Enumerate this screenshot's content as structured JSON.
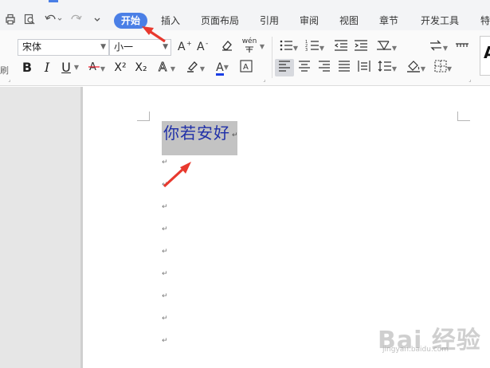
{
  "quick_access": {
    "icons": [
      "print-icon",
      "print-preview-icon",
      "undo-icon",
      "redo-icon",
      "customize-dropdown-icon"
    ]
  },
  "tabs": [
    {
      "label": "开始",
      "active": true
    },
    {
      "label": "插入"
    },
    {
      "label": "页面布局"
    },
    {
      "label": "引用"
    },
    {
      "label": "审阅"
    },
    {
      "label": "视图"
    },
    {
      "label": "章节"
    },
    {
      "label": "开发工具"
    },
    {
      "label": "特"
    }
  ],
  "ribbon": {
    "font_name": "宋体",
    "font_size": "小一",
    "row1_icons": [
      "increase-font-size-icon",
      "decrease-font-size-icon",
      "clear-format-icon",
      "pinyin-guide-icon",
      "bullet-list-icon",
      "numbered-list-icon",
      "decrease-indent-icon",
      "increase-indent-icon",
      "chinese-layout-icon",
      "sort-icon",
      "show-hide-marks-icon"
    ],
    "row2_icons": [
      "bold-icon",
      "italic-icon",
      "underline-icon",
      "strikethrough-icon",
      "superscript-icon",
      "subscript-icon",
      "text-effect-icon",
      "highlight-icon",
      "font-color-icon",
      "char-border-icon",
      "align-left-icon",
      "align-center-icon",
      "align-right-icon",
      "justify-icon",
      "distributed-icon",
      "line-spacing-icon",
      "shading-icon",
      "borders-icon"
    ],
    "bold": "B",
    "italic": "I",
    "underline": "U",
    "superscript": "X²",
    "subscript": "X₂",
    "font_color_glyph": "A",
    "font_color": "#1a3ee6",
    "pinyin": "wén",
    "style_preview": "A",
    "active_alignment": "left",
    "left_cut_text": "刷"
  },
  "document": {
    "first_line": "你若安好",
    "paragraph_mark": "↵",
    "empty_paragraph_count": 9,
    "text_color": "#1f2fa8",
    "selected": true
  },
  "watermark": {
    "text": "Bai 经验",
    "sub": "jingyan.baidu.com"
  },
  "colors": {
    "accent": "#4a7fe6",
    "arrow": "#e8392e",
    "selection": "#c3c3c3"
  }
}
